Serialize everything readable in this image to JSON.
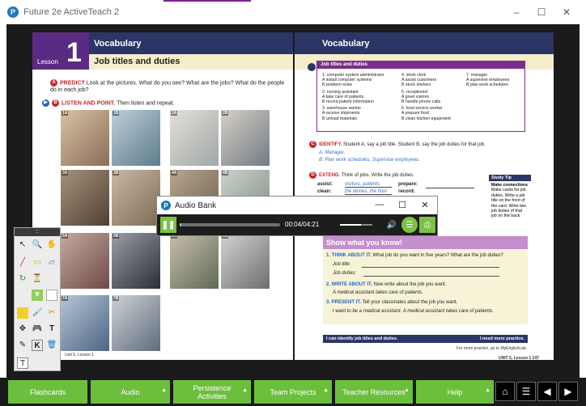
{
  "window": {
    "title": "Future 2e ActiveTeach 2",
    "minimize": "–",
    "maximize": "☐",
    "close": "✕",
    "logo_letter": "P"
  },
  "left_page": {
    "vocab_label": "Vocabulary",
    "lesson_word": "Lesson",
    "lesson_number": "1",
    "subtitle": "Job titles and duties",
    "predict_badge": "A",
    "predict_title": "PREDICT",
    "predict_text": "Look at the pictures. What do you see? What are the jobs? What do the people do in each job?",
    "listen_badge": "B",
    "listen_title": "LISTEN AND POINT.",
    "listen_text": "Then listen and repeat.",
    "photos": [
      "1A",
      "1B",
      "2A",
      "2B",
      "3A",
      "3B",
      "4A",
      "4B",
      "5A",
      "5B",
      "6A",
      "6B",
      "7A",
      "7B"
    ],
    "footer": "Unit 5, Lesson 1"
  },
  "right_page": {
    "vocab_label": "Vocabulary",
    "box_title": "Job titles and duties",
    "col1": [
      "1. computer system administrator",
      "A install computer systems",
      "B problem solve",
      "2. nursing assistant",
      "A take care of patients",
      "B record patient information",
      "3. warehouse worker",
      "A receive shipments",
      "B unload materials"
    ],
    "col2": [
      "4. stock clerk",
      "A assist customers",
      "B stock shelves",
      "5. receptionist",
      "A greet visitors",
      "B handle phone calls",
      "6. food service worker",
      "A prepare food",
      "B clean kitchen equipment"
    ],
    "col3": [
      "7. manager",
      "A supervise employees",
      "B plan work schedules"
    ],
    "identify_badge": "C",
    "identify_title": "IDENTIFY.",
    "identify_text": "Student A, say a job title. Student B, say the job duties for that job.",
    "identify_a": "A: Manager.",
    "identify_b": "B: Plan work schedules. Supervise employees.",
    "extend_badge": "D",
    "extend_title": "EXTEND.",
    "extend_text": "Think of jobs. Write the job duties.",
    "assist_label": "assist:",
    "assist_answer": "visitors, patients",
    "clean_label": "clean:",
    "clean_answer": "the dishes, the floor",
    "prepare_label": "prepare:",
    "record_label": "record:",
    "study_tip_title": "Study Tip",
    "study_tip_head": "Make connections",
    "study_tip_body": "Make cards for job duties. Write a job title on the front of the card. Write two job duties of that job on the back.",
    "show_title": "Show what you know!",
    "think_title": "1. THINK ABOUT IT.",
    "think_text": "What job do you want in five years? What are the job duties?",
    "job_title_label": "Job title:",
    "job_duties_label": "Job duties:",
    "write_title": "2. WRITE ABOUT IT.",
    "write_text": "Now write about the job you want.",
    "write_example": "A medical assistant takes care of patients.",
    "present_title": "3. PRESENT IT.",
    "present_text": "Tell your classmates about the job you want.",
    "present_example": "I want to be a medical assistant. A medical assistant takes care of patients.",
    "can_do": "I can identify job titles and duties.",
    "need_practice": "I need more practice.",
    "more_practice": "For more practice, go to MyEnglishLab.",
    "page_footer": "UNIT 5, Lesson 1   147"
  },
  "audio_bank": {
    "title": "Audio Bank",
    "time": "00:04/04:21",
    "progress": 0.016,
    "volume": 0.65,
    "pause_icon": "❚❚",
    "minimize": "—",
    "restore": "☐",
    "close": "✕",
    "volume_icon": "🔊",
    "script_icon": "☰",
    "print_icon": "⎙"
  },
  "palette": {
    "handle": "::",
    "tools": [
      "↖",
      "🔍",
      "✋",
      "╱",
      "▭",
      "▱",
      "↻",
      "⏳",
      "▼",
      "■",
      "🖌",
      "✂",
      "✥",
      "🎮",
      "T",
      "✎",
      "K",
      "🗑",
      "T"
    ]
  },
  "bottom_nav": {
    "buttons": [
      "Flashcards",
      "Audio",
      "Persistence Activities",
      "Team Projects",
      "Teacher Resources",
      "Help"
    ],
    "arrow": "▲",
    "home_icon": "⌂",
    "menu_icon": "☰",
    "prev_icon": "◀",
    "next_icon": "▶"
  }
}
